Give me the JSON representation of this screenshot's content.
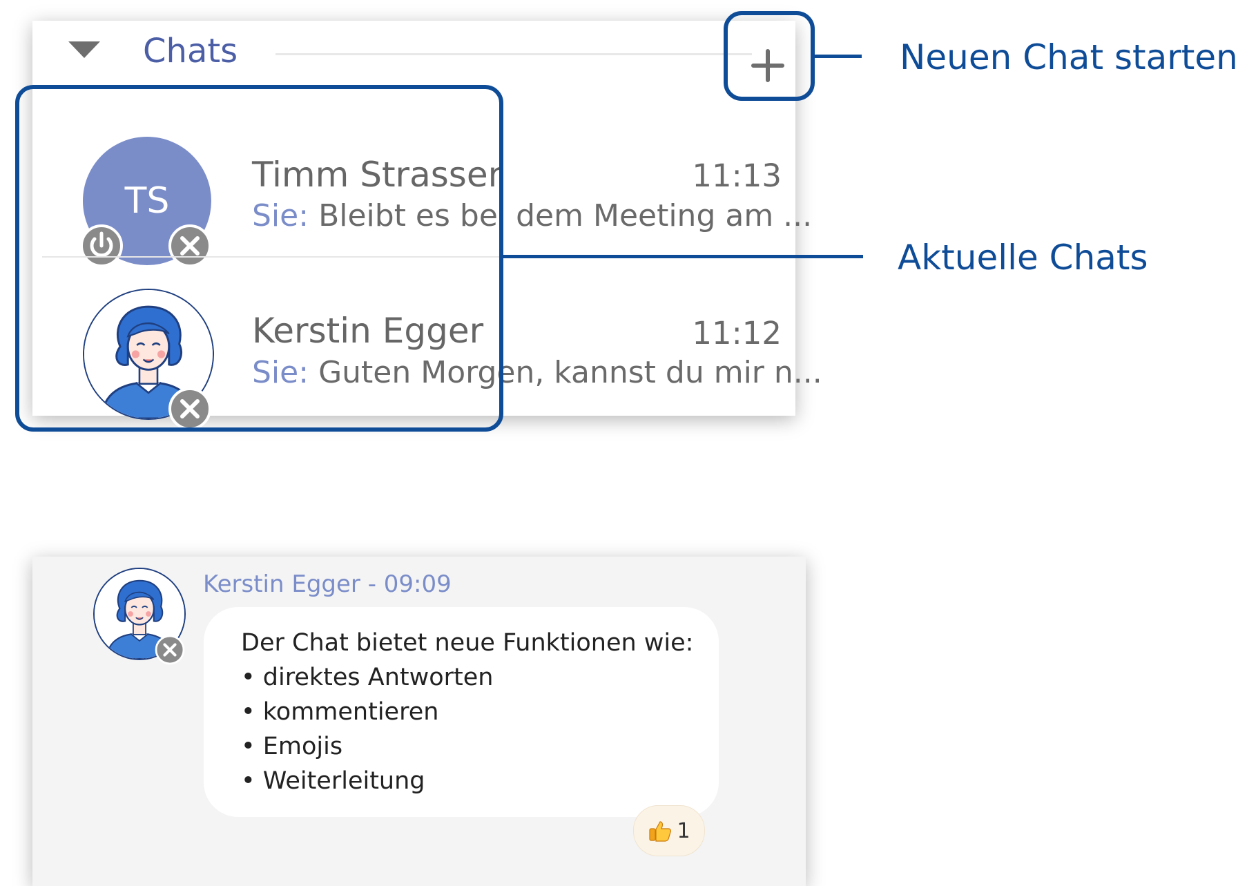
{
  "chats_panel": {
    "title": "Chats",
    "chats": [
      {
        "initials": "TS",
        "name": "Timm Strasser",
        "time": "11:13",
        "sender": "Sie:",
        "preview": "Bleibt es bei dem Meeting am ..."
      },
      {
        "name": "Kerstin Egger",
        "time": "11:12",
        "sender": "Sie:",
        "preview": "Guten Morgen, kannst du mir n..."
      }
    ]
  },
  "callouts": {
    "new_chat": "Neuen Chat starten",
    "current_chats": "Aktuelle Chats"
  },
  "message": {
    "header": "Kerstin Egger - 09:09",
    "lines": [
      "Der Chat bietet neue Funktionen wie:",
      "• direktes Antworten",
      "• kommentieren",
      "• Emojis",
      "• Weiterleitung"
    ],
    "reaction_count": "1"
  },
  "colors": {
    "accent": "#0f4c97",
    "user_blue": "#7b8dc9",
    "title_blue": "#4b5ea6"
  }
}
